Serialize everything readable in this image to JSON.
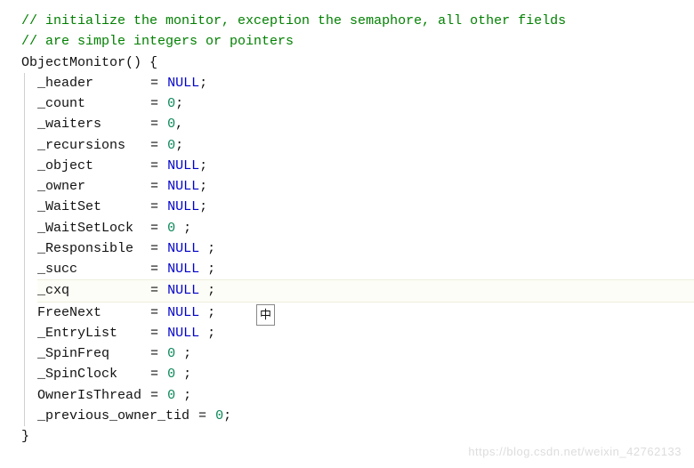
{
  "comment1": "// initialize the monitor, exception the semaphore, all other fields",
  "comment2": "// are simple integers or pointers",
  "funcName": "ObjectMonitor",
  "parens": "()",
  "openBrace": " {",
  "closeBrace": "}",
  "eq": "=",
  "semi": ";",
  "comma": ",",
  "fields": [
    {
      "name": "_header",
      "val": "NULL",
      "term": ";"
    },
    {
      "name": "_count",
      "val": "0",
      "term": ";"
    },
    {
      "name": "_waiters",
      "val": "0",
      "term": ","
    },
    {
      "name": "_recursions",
      "val": "0",
      "term": ";"
    },
    {
      "name": "_object",
      "val": "NULL",
      "term": ";"
    },
    {
      "name": "_owner",
      "val": "NULL",
      "term": ";"
    },
    {
      "name": "_WaitSet",
      "val": "NULL",
      "term": ";"
    },
    {
      "name": "_WaitSetLock",
      "val": "0",
      "term": " ;"
    },
    {
      "name": "_Responsible",
      "val": "NULL",
      "term": " ;"
    },
    {
      "name": "_succ",
      "val": "NULL",
      "term": " ;"
    },
    {
      "name": "_cxq",
      "val": "NULL",
      "term": " ;",
      "cursor": true
    },
    {
      "name": "FreeNext",
      "val": "NULL",
      "term": " ;",
      "ime": true
    },
    {
      "name": "_EntryList",
      "val": "NULL",
      "term": " ;"
    },
    {
      "name": "_SpinFreq",
      "val": "0",
      "term": " ;"
    },
    {
      "name": "_SpinClock",
      "val": "0",
      "term": " ;"
    },
    {
      "name": "OwnerIsThread",
      "val": "0",
      "term": " ;"
    }
  ],
  "lastLineName": "_previous_owner_tid",
  "lastLineVal": "0",
  "imeLabel": "中",
  "watermark": "https://blog.csdn.net/weixin_42762133"
}
